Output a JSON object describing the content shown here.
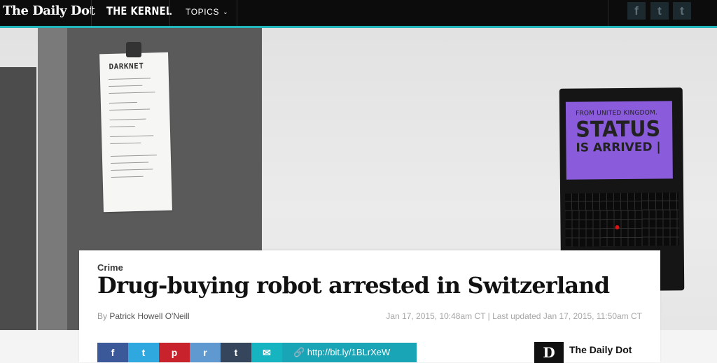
{
  "nav": {
    "logo": "The Daily Dot",
    "kernel": "THE KERNEL",
    "topics": "TOPICS",
    "social": [
      {
        "label": "f",
        "icon": "facebook-icon"
      },
      {
        "label": "t",
        "icon": "twitter-icon"
      },
      {
        "label": "t",
        "icon": "tumblr-icon"
      }
    ]
  },
  "hero": {
    "paper_title": "DARKNET",
    "screen_line1": "FROM UNITED KINGDOM.",
    "screen_line2": "STATUS",
    "screen_line3": "IS ARRIVED |"
  },
  "article": {
    "category": "Crime",
    "headline": "Drug-buying robot arrested in Switzerland",
    "by": "By",
    "author": "Patrick Howell O'Neill",
    "published": "Jan 17, 2015, 10:48am CT",
    "updated": "Last updated Jan 17, 2015, 11:50am CT"
  },
  "share": {
    "buttons": [
      {
        "label": "f",
        "icon": "facebook-icon",
        "color": "#3b5998"
      },
      {
        "label": "t",
        "icon": "twitter-icon",
        "color": "#2fa8e0"
      },
      {
        "label": "p",
        "icon": "pinterest-icon",
        "color": "#c8232c"
      },
      {
        "label": "r",
        "icon": "reddit-icon",
        "color": "#5f99cf"
      },
      {
        "label": "t",
        "icon": "tumblr-icon",
        "color": "#35465c"
      },
      {
        "label": "✉",
        "icon": "email-icon",
        "color": "#16b3c0"
      }
    ],
    "short_url": "🔗 http://bit.ly/1BLrXeW"
  },
  "publisher": {
    "logo": "D",
    "name": "The Daily Dot"
  },
  "colors": {
    "accent": "#23b7bd",
    "nav_bg": "#0c0c0c"
  }
}
